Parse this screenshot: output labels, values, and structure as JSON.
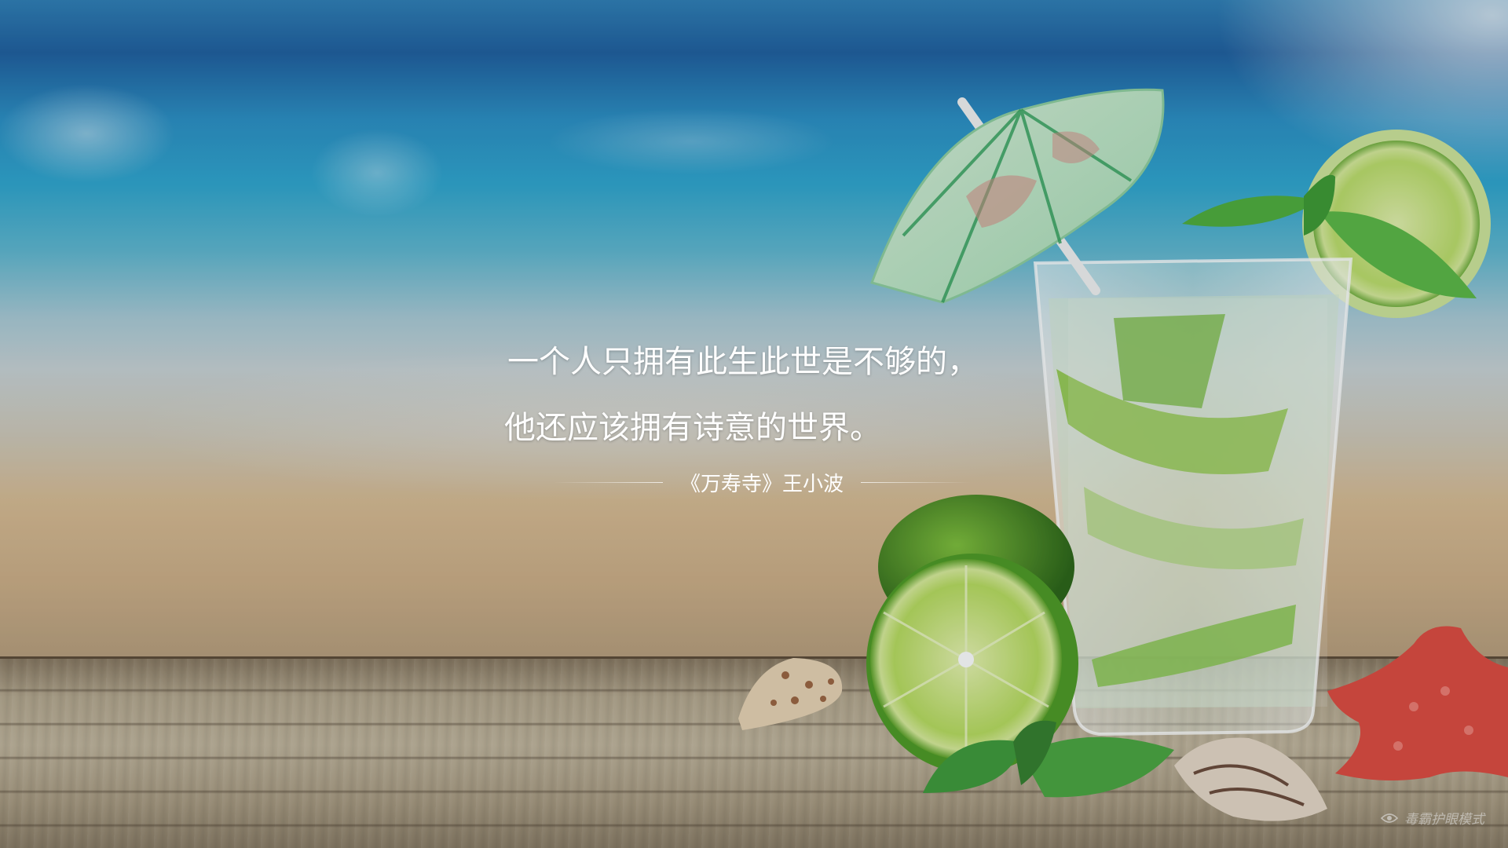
{
  "quote": {
    "line1": "一个人只拥有此生此世是不够的，",
    "line2": "他还应该拥有诗意的世界。",
    "attribution": "《万寿寺》王小波"
  },
  "watermark": {
    "text": "毒霸护眼模式",
    "icon": "eye-icon"
  },
  "colors": {
    "sky_top": "#1f5f9f",
    "sea": "#2fa6cf",
    "sand": "#d8bb92",
    "wood": "#b6a88e",
    "lime": "#8cc63f",
    "lime_dark": "#3e7d1f",
    "mint": "#3f9a3a",
    "starfish": "#e0473f",
    "text": "#ffffff"
  }
}
